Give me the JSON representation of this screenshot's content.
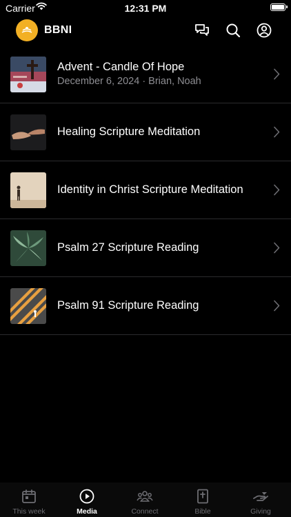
{
  "status_bar": {
    "carrier": "Carrier",
    "time": "12:31 PM"
  },
  "header": {
    "title": "BBNI",
    "icons": [
      "chat-icon",
      "search-icon",
      "account-icon"
    ]
  },
  "items": [
    {
      "title": "Advent - Candle Of Hope",
      "subtitle": "December 6, 2024 · Brian, Noah"
    },
    {
      "title": "Healing Scripture Meditation",
      "subtitle": ""
    },
    {
      "title": "Identity in Christ Scripture Meditation",
      "subtitle": ""
    },
    {
      "title": "Psalm 27 Scripture Reading",
      "subtitle": ""
    },
    {
      "title": "Psalm 91 Scripture Reading",
      "subtitle": ""
    }
  ],
  "tabs": [
    {
      "label": "This week",
      "icon": "calendar-icon"
    },
    {
      "label": "Media",
      "icon": "play-icon",
      "active": true
    },
    {
      "label": "Connect",
      "icon": "people-icon"
    },
    {
      "label": "Bible",
      "icon": "bible-icon"
    },
    {
      "label": "Giving",
      "icon": "giving-hand-icon"
    }
  ],
  "colors": {
    "background": "#000000",
    "logo": "#f2b024",
    "secondary_text": "#8e8e93",
    "inactive_tab": "#6e6e73"
  }
}
